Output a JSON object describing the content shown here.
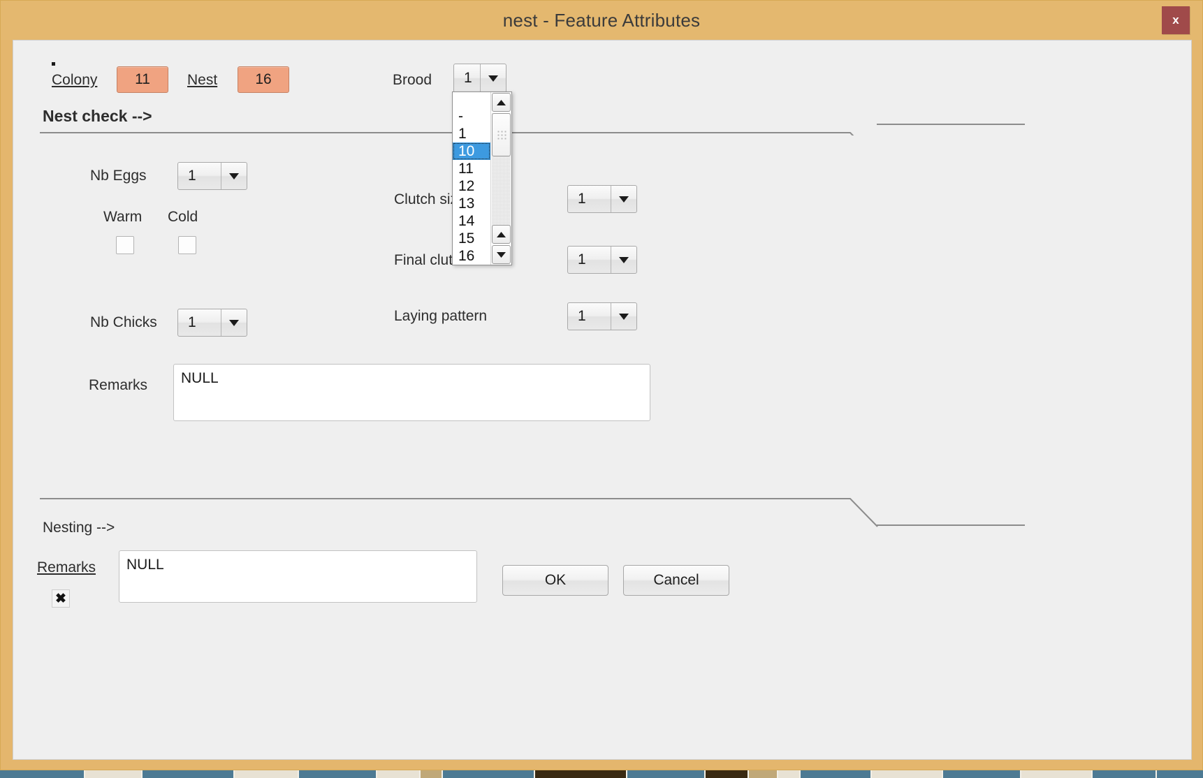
{
  "window": {
    "title": "nest - Feature Attributes",
    "close_label": "x",
    "titlebar_color": "#e4b86f",
    "close_color": "#a04a4a",
    "client_color": "#efefef"
  },
  "header": {
    "colony_label": "Colony",
    "colony_value": "11",
    "nest_label": "Nest",
    "nest_value": "16",
    "brood_label": "Brood",
    "brood_value": "1",
    "keybox_color": "#f0a381"
  },
  "groups": {
    "nest_check_title": "Nest check -->",
    "nesting_title": "Nesting -->"
  },
  "nest_check": {
    "nb_eggs_label": "Nb Eggs",
    "nb_eggs_value": "1",
    "warm_label": "Warm",
    "cold_label": "Cold",
    "nb_chicks_label": "Nb Chicks",
    "nb_chicks_value": "1",
    "clutch_size_label": "Clutch size",
    "clutch_size_value": "1",
    "final_clutch_label": "Final clutch",
    "final_clutch_value": "1",
    "laying_pattern_label": "Laying pattern",
    "laying_pattern_value": "1",
    "remarks_label": "Remarks",
    "remarks_value": "NULL"
  },
  "nesting": {
    "remarks_label": "Remarks",
    "remarks_value": "NULL",
    "clear_glyph": "✖"
  },
  "buttons": {
    "ok_label": "OK",
    "cancel_label": "Cancel"
  },
  "brood_dropdown": {
    "open": true,
    "selected": "10",
    "highlight_color": "#3d9ae0",
    "items": [
      "-",
      "1",
      "10",
      "11",
      "12",
      "13",
      "14",
      "15",
      "16"
    ]
  }
}
